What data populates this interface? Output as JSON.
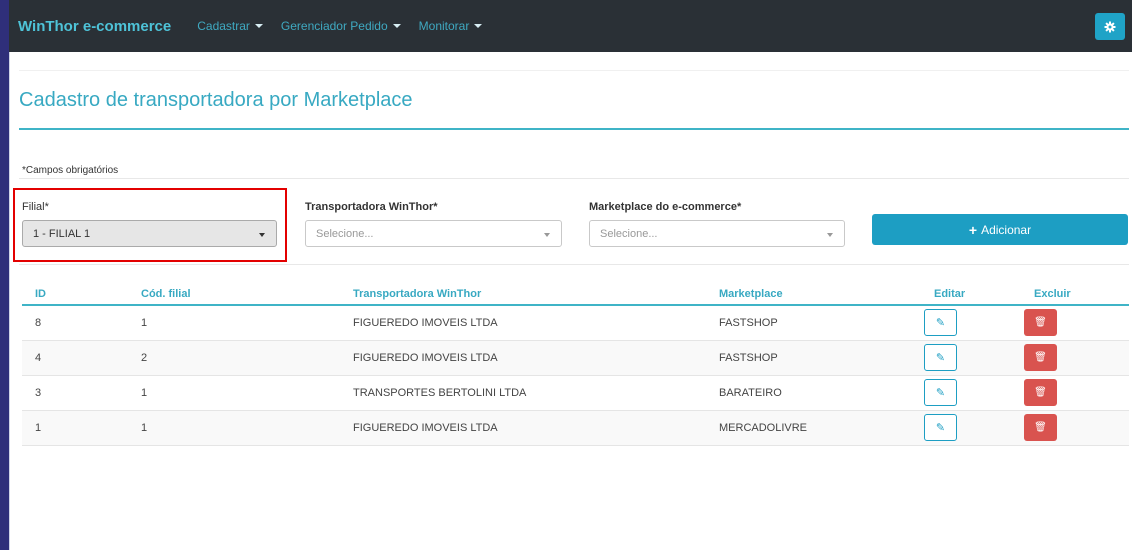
{
  "navbar": {
    "brand": "WinThor e-commerce",
    "menu": [
      {
        "label": "Cadastrar"
      },
      {
        "label": "Gerenciador Pedido"
      },
      {
        "label": "Monitorar"
      }
    ],
    "settings_icon": "gear-icon"
  },
  "page": {
    "title": "Cadastro de transportadora por Marketplace",
    "required_note": "*Campos obrigatórios"
  },
  "form": {
    "filial": {
      "label": "Filial*",
      "value": "1 - FILIAL 1"
    },
    "transportadora": {
      "label": "Transportadora WinThor*",
      "placeholder": "Selecione..."
    },
    "marketplace": {
      "label": "Marketplace do e-commerce*",
      "placeholder": "Selecione..."
    },
    "add_button": {
      "label": "Adicionar",
      "icon": "plus-icon"
    }
  },
  "table": {
    "headers": [
      "ID",
      "Cód. filial",
      "Transportadora WinThor",
      "Marketplace",
      "Editar",
      "Excluir"
    ],
    "rows": [
      {
        "id": "8",
        "cod_filial": "1",
        "transportadora": "FIGUEREDO IMOVEIS LTDA",
        "marketplace": "FASTSHOP"
      },
      {
        "id": "4",
        "cod_filial": "2",
        "transportadora": "FIGUEREDO IMOVEIS LTDA",
        "marketplace": "FASTSHOP"
      },
      {
        "id": "3",
        "cod_filial": "1",
        "transportadora": "TRANSPORTES BERTOLINI LTDA",
        "marketplace": "BARATEIRO"
      },
      {
        "id": "1",
        "cod_filial": "1",
        "transportadora": "FIGUEREDO IMOVEIS LTDA",
        "marketplace": "MERCADOLIVRE"
      }
    ],
    "edit_icon": "edit-icon",
    "delete_icon": "trash-icon"
  },
  "colors": {
    "accent": "#38a9c2",
    "navbar_bg": "#2a3036",
    "primary_button": "#1d9ec3",
    "danger_button": "#d9534f",
    "highlight_border": "#e30000"
  }
}
